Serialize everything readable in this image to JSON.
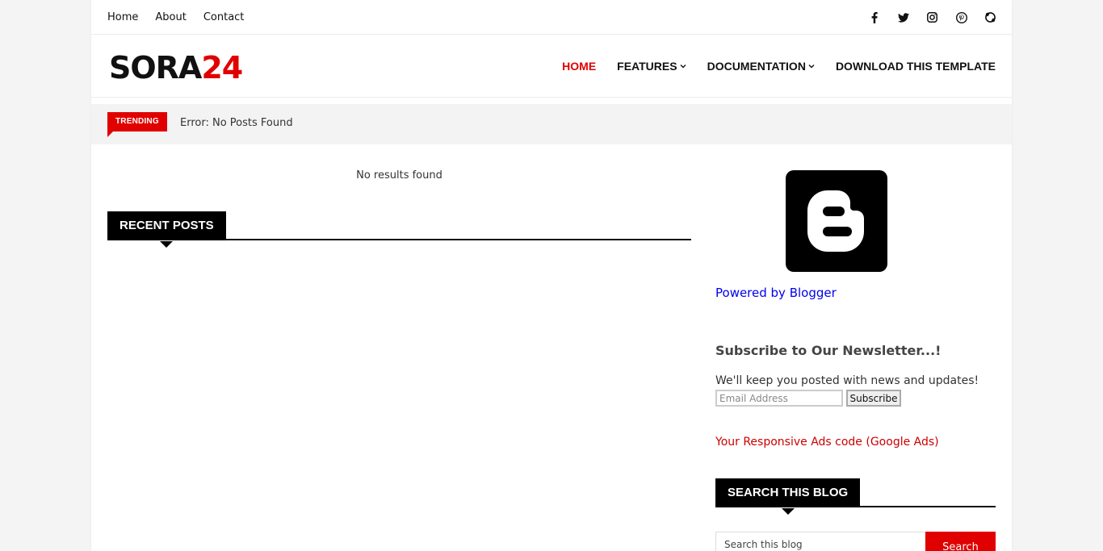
{
  "top_links": [
    "Home",
    "About",
    "Contact"
  ],
  "social_icons": [
    "facebook-icon",
    "twitter-icon",
    "instagram-icon",
    "pinterest-icon",
    "skype-icon"
  ],
  "logo": {
    "part1": "SORA",
    "part2": "24"
  },
  "nav": {
    "home": "HOME",
    "features": "FEATURES",
    "documentation": "DOCUMENTATION",
    "download": "DOWNLOAD THIS TEMPLATE"
  },
  "trending": {
    "label": "TRENDING",
    "text": "Error: No Posts Found"
  },
  "main": {
    "no_results": "No results found",
    "recent_posts": "RECENT POSTS"
  },
  "sidebar": {
    "powered_by": "Powered by Blogger",
    "newsletter_title": "Subscribe to Our Newsletter...!",
    "newsletter_text": "We'll keep you posted with news and updates!",
    "email_placeholder": "Email Address",
    "subscribe_label": "Subscribe",
    "ads_text": "Your Responsive Ads code (Google Ads)",
    "search_heading": "SEARCH THIS BLOG",
    "search_placeholder": "Search this blog",
    "search_button": "Search"
  },
  "colors": {
    "accent": "#e10000",
    "dark": "#000000",
    "link_blue": "#0000ee"
  }
}
